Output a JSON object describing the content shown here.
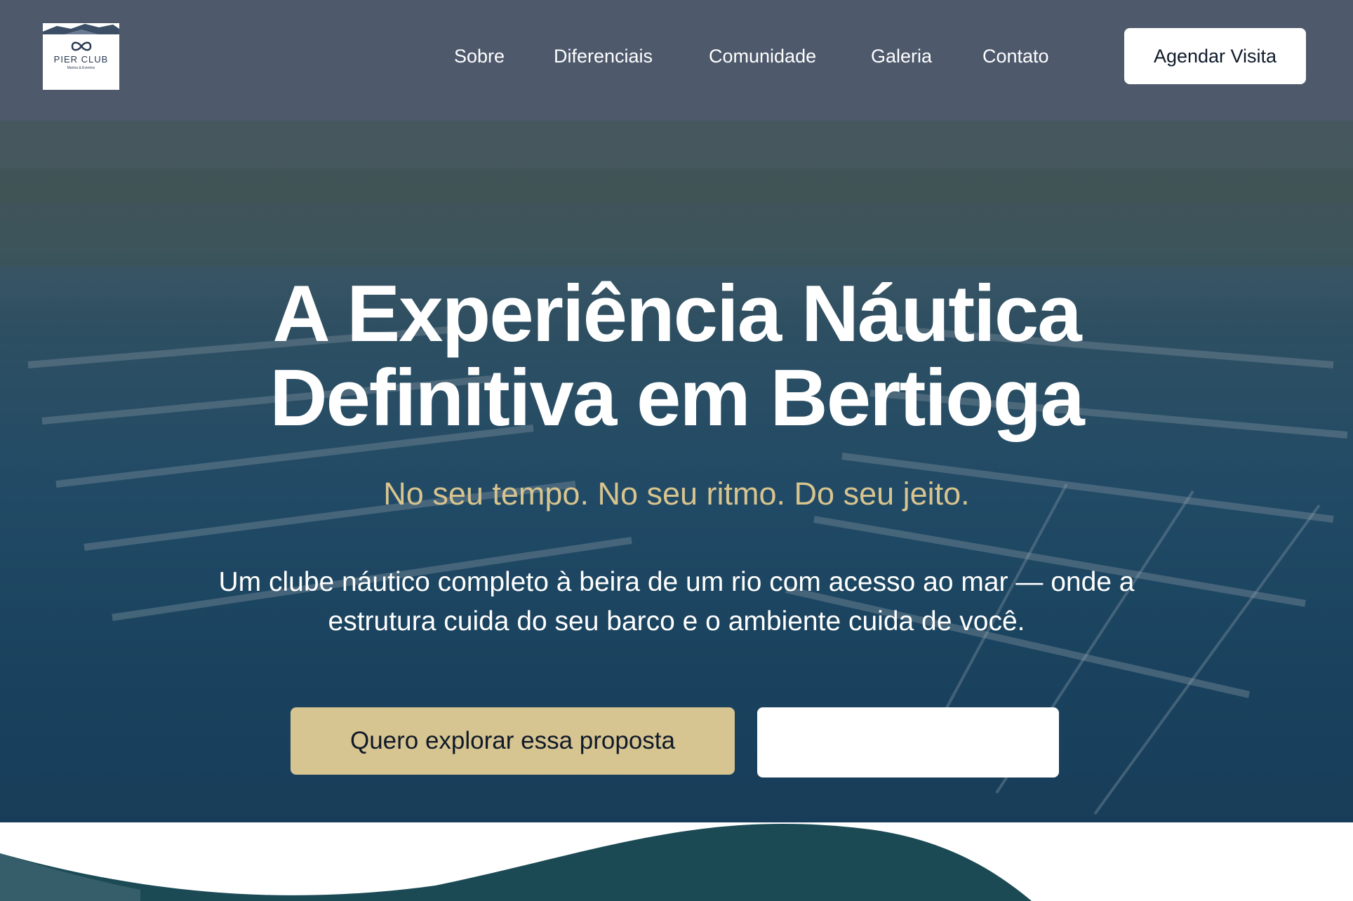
{
  "brand": {
    "name": "PIER CLUB",
    "subtitle": "Marina & Eventos"
  },
  "nav": {
    "links": [
      "Sobre",
      "Diferenciais",
      "Comunidade",
      "Galeria",
      "Contato"
    ],
    "cta_label": "Agendar Visita"
  },
  "hero": {
    "title_line1": "A Experiência Náutica",
    "title_line2": "Definitiva em Bertioga",
    "tagline": "No seu tempo. No seu ritmo. Do seu jeito.",
    "description_line1": "Um clube náutico completo à beira de um rio com acesso ao mar — onde a",
    "description_line2": "estrutura cuida do seu barco e o ambiente cuida de você.",
    "primary_button": "Quero explorar essa proposta",
    "secondary_button": ""
  },
  "colors": {
    "navbar": "#4e5a6c",
    "accent_gold": "#d6c491",
    "tagline_gold": "#d8c48e",
    "wave_teal": "#1b4a55",
    "text_dark": "#101a28"
  },
  "icons": {
    "logo": "infinity-knot-icon"
  }
}
